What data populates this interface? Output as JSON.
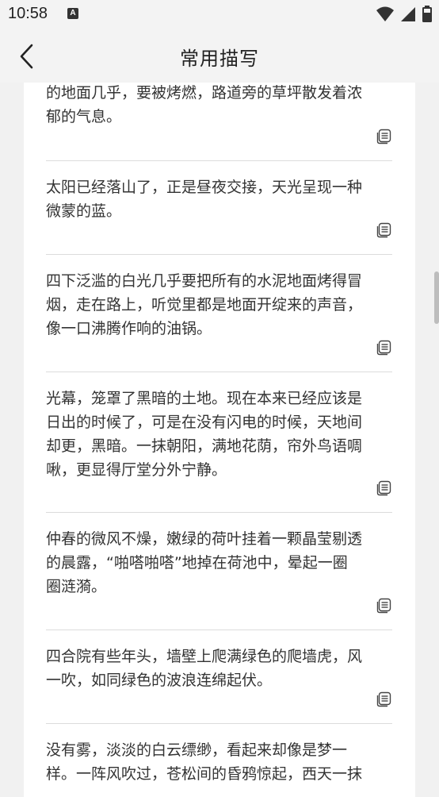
{
  "status_bar": {
    "time": "10:58",
    "notification_icon": "A",
    "icons": [
      "wifi-icon",
      "signal-icon",
      "battery-icon"
    ]
  },
  "header": {
    "title": "常用描写",
    "back_icon": "chevron-left-icon"
  },
  "items": [
    {
      "text": "的地面几乎，要被烤燃，路道旁的草坪散发着浓\n郁的气息。"
    },
    {
      "text": "太阳已经落山了，正是昼夜交接，天光呈现一种\n微蒙的蓝。"
    },
    {
      "text": "四下泛滥的白光几乎要把所有的水泥地面烤得冒\n烟，走在路上，听觉里都是地面开绽来的声音，\n像一口沸腾作响的油锅。"
    },
    {
      "text": "光幕，笼罩了黑暗的土地。现在本来已经应该是\n日出的时候了，可是在没有闪电的时候，天地间\n却更，黑暗。一抹朝阳，满地花荫，帘外鸟语啁\n啾，更显得厅堂分外宁静。"
    },
    {
      "text": "仲春的微风不燥，嫩绿的荷叶挂着一颗晶莹剔透\n的晨露，“啪嗒啪嗒”地掉在荷池中，晕起一圈\n圈涟漪。"
    },
    {
      "text": "四合院有些年头，墙壁上爬满绿色的爬墙虎，风\n一吹，如同绿色的波浪连绵起伏。"
    },
    {
      "text": "没有雾，淡淡的白云缥缈，看起来却像是梦一\n样。一阵风吹过，苍松间的昏鸦惊起，西天一抹"
    }
  ],
  "colors": {
    "background": "#f1f1f1",
    "card": "#ffffff",
    "divider": "#dcdcdc",
    "text": "#333333"
  }
}
